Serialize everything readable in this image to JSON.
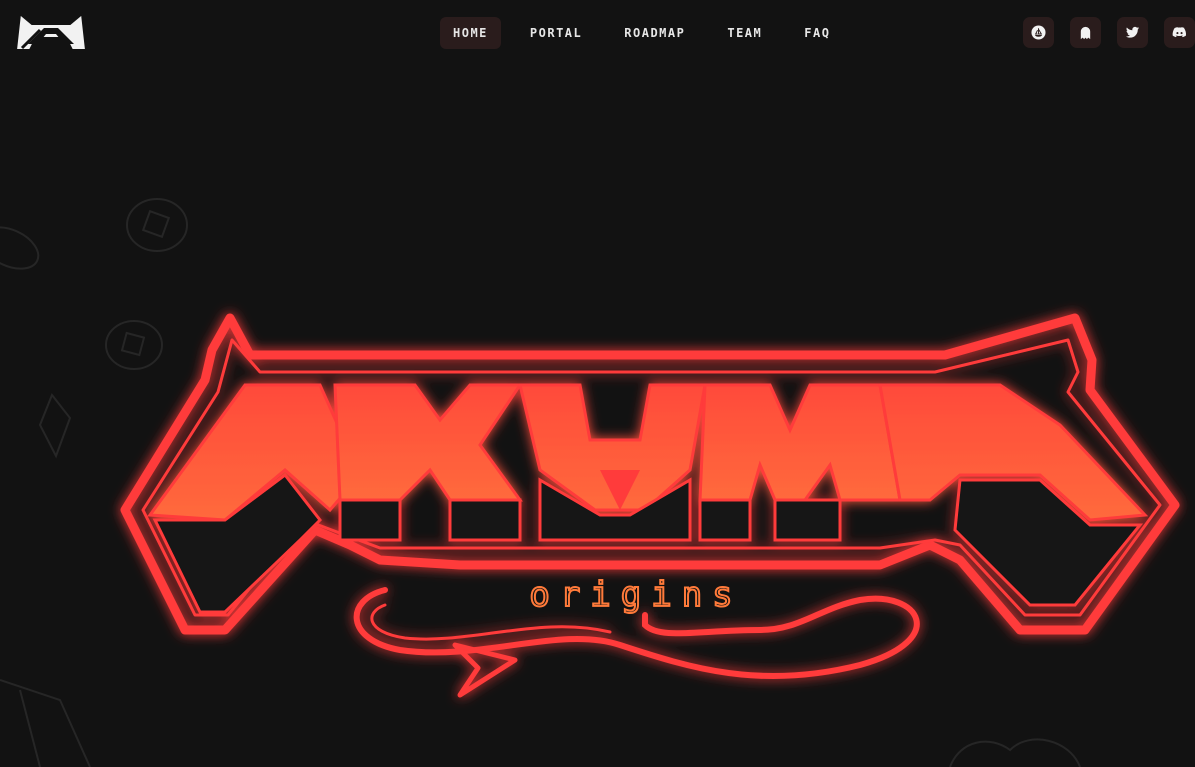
{
  "brand": {
    "logo_icon": "akumu-mask-logo-icon"
  },
  "nav": {
    "items": [
      {
        "label": "HOME",
        "active": true
      },
      {
        "label": "PORTAL",
        "active": false
      },
      {
        "label": "ROADMAP",
        "active": false
      },
      {
        "label": "TEAM",
        "active": false
      },
      {
        "label": "FAQ",
        "active": false
      }
    ]
  },
  "socials": [
    {
      "icon": "opensea-icon"
    },
    {
      "icon": "ghost-icon"
    },
    {
      "icon": "twitter-icon"
    },
    {
      "icon": "discord-icon"
    }
  ],
  "hero": {
    "subtitle": "origins"
  },
  "colors": {
    "background": "#121212",
    "accent_red": "#ff3a3a",
    "logo_fill": "#ff5a3c",
    "origins_orange": "#ff7a3a",
    "nav_active_bg": "#2a1c1c"
  }
}
